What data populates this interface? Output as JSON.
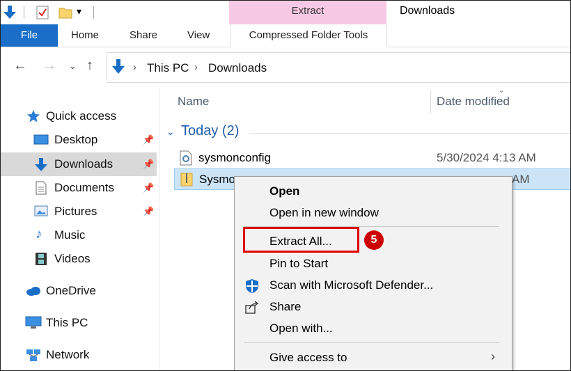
{
  "title_bar": {
    "contextual_tab_group": "Extract",
    "window_title": "Downloads"
  },
  "ribbon": {
    "file": "File",
    "home": "Home",
    "share": "Share",
    "view": "View",
    "compressed_folder_tools": "Compressed Folder Tools"
  },
  "address": {
    "crumbs": [
      "This PC",
      "Downloads"
    ]
  },
  "nav": {
    "quick_access": "Quick access",
    "desktop": "Desktop",
    "downloads": "Downloads",
    "documents": "Documents",
    "pictures": "Pictures",
    "music": "Music",
    "videos": "Videos",
    "onedrive": "OneDrive",
    "this_pc": "This PC",
    "network": "Network"
  },
  "columns": {
    "name": "Name",
    "date_modified": "Date modified"
  },
  "group": {
    "label": "Today (2)"
  },
  "files": [
    {
      "name": "sysmonconfig",
      "date": "5/30/2024 4:13 AM"
    },
    {
      "name": "Sysmo",
      "date": "AM"
    }
  ],
  "context_menu": {
    "open": "Open",
    "open_new_window": "Open in new window",
    "extract_all": "Extract All...",
    "pin_to_start": "Pin to Start",
    "scan_defender": "Scan with Microsoft Defender...",
    "share": "Share",
    "open_with": "Open with...",
    "give_access": "Give access to"
  },
  "annotation": {
    "step_number": "5"
  },
  "colors": {
    "accent": "#1a6ec7",
    "contextual_tab": "#f7c9e4",
    "selection": "#cce4f7",
    "highlight": "#e00000"
  }
}
